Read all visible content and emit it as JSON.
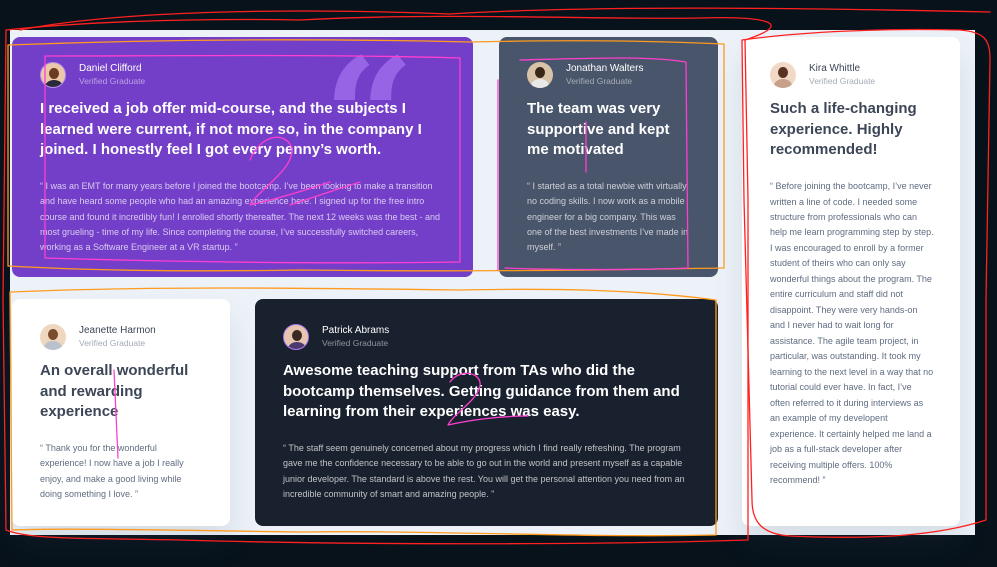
{
  "testimonials": [
    {
      "name": "Daniel Clifford",
      "role": "Verified Graduate",
      "headline": "I received a job offer mid-course, and the subjects I learned were current, if not more so, in the company I joined. I honestly feel I got every penny’s worth.",
      "quote": "“ I was an EMT for many years before I joined the bootcamp. I’ve been looking to make a transition and have heard some people who had an amazing experience here. I signed up for the free intro course and found it incredibly fun! I enrolled shortly thereafter. The next 12 weeks was the best - and most grueling - time of my life. Since completing the course, I’ve successfully switched careers, working as a Software Engineer at a VR startup. ”"
    },
    {
      "name": "Jonathan Walters",
      "role": "Verified Graduate",
      "headline": "The team was very supportive and kept me motivated",
      "quote": "“ I started as a total newbie with virtually no coding skills. I now work as a mobile engineer for a big company. This was one of the best investments I’ve made in myself. ”"
    },
    {
      "name": "Kira Whittle",
      "role": "Verified Graduate",
      "headline": "Such a life-changing experience. Highly recommended!",
      "quote": "“ Before joining the bootcamp, I’ve never written a line of code. I needed some structure from professionals who can help me learn programming step by step. I was encouraged to enroll by a former student of theirs who can only say wonderful things about the program. The entire curriculum and staff did not disappoint. They were very hands-on and I never had to wait long for assistance. The agile team project, in particular, was outstanding. It took my learning to the next level in a way that no tutorial could ever have. In fact, I’ve often referred to it during interviews as an example of my developent experience. It certainly helped me land a job as a full-stack developer after receiving multiple offers. 100% recommend! ”"
    },
    {
      "name": "Jeanette Harmon",
      "role": "Verified Graduate",
      "headline": "An overall wonderful and rewarding experience",
      "quote": "“ Thank you for the wonderful experience! I now have a job I really enjoy, and make a good living while doing something I love. ”"
    },
    {
      "name": "Patrick Abrams",
      "role": "Verified Graduate",
      "headline": "Awesome teaching support from TAs who did the bootcamp themselves. Getting guidance from them and learning from their experiences was easy.",
      "quote": "“ The staff seem genuinely concerned about my progress which I find really refreshing. The program gave me the confidence necessary to be able to go out in the world and present myself as a capable junior developer. The standard is above the rest. You will get the personal attention you need from an incredible community of smart and amazing people. ”"
    }
  ],
  "annotation_marks": [
    "2",
    "1",
    "2",
    "1",
    "2"
  ],
  "colors": {
    "purple": "#733fc8",
    "slate": "#48556a",
    "dark": "#19212e",
    "page_bg": "#ecf2f8",
    "outer_bg": "#07121b",
    "annotation_red": "#ff2020",
    "annotation_orange": "#ff9a1e",
    "annotation_pink": "#ff3fd0"
  }
}
